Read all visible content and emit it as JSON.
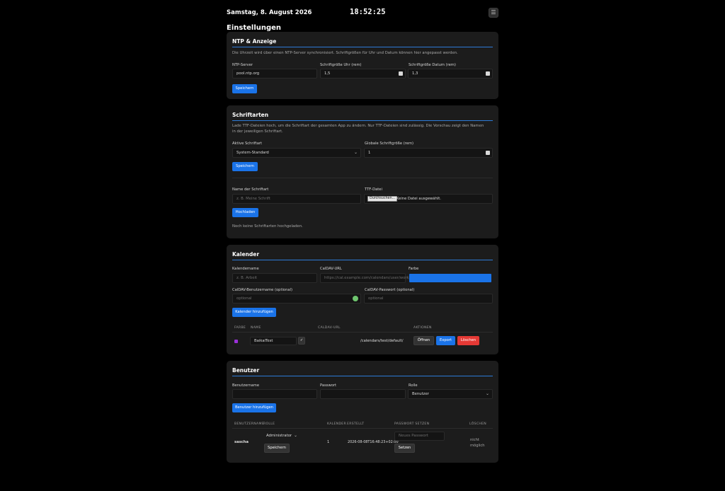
{
  "header": {
    "date": "Samstag, 8. August 2026",
    "clock": "18:52:25",
    "menu_icon": "menu-icon"
  },
  "page_title": "Einstellungen",
  "ntp": {
    "title": "NTP & Anzeige",
    "description": "Die Uhrzeit wird über einen NTP-Server synchronisiert. Schriftgrößen für Uhr und Datum können hier angepasst werden.",
    "server_label": "NTP-Server",
    "server_value": "pool.ntp.org",
    "clock_size_label": "Schriftgröße Uhr (rem)",
    "clock_size_value": "1,5",
    "date_size_label": "Schriftgröße Datum (rem)",
    "date_size_value": "1,3",
    "save": "Speichern"
  },
  "fonts": {
    "title": "Schriftarten",
    "description": "Lade TTF-Dateien hoch, um die Schriftart der gesamten App zu ändern. Nur TTF-Dateien sind zulässig. Die Vorschau zeigt den Namen in der jeweiligen Schriftart.",
    "active_label": "Aktive Schriftart",
    "active_value": "System-Standard",
    "global_size_label": "Globale Schriftgröße (rem)",
    "global_size_value": "1",
    "save": "Speichern",
    "name_label": "Name der Schriftart",
    "name_placeholder": "z. B. Meine Schrift",
    "file_label": "TTF-Datei",
    "file_button": "Durchsuchen...",
    "file_status": "Keine Datei ausgewählt.",
    "upload": "Hochladen",
    "empty": "Noch keine Schriftarten hochgeladen."
  },
  "calendar": {
    "title": "Kalender",
    "name_label": "Kalendername",
    "name_placeholder": "z. B. Arbeit",
    "url_label": "CalDAV-URL",
    "url_placeholder": "https://cal.example.com/calendars/user/work/",
    "color_label": "Farbe",
    "color_value": "#1a73e8",
    "user_label": "CalDAV-Benutzername (optional)",
    "user_placeholder": "optional",
    "pass_label": "CalDAV-Passwort (optional)",
    "pass_placeholder": "optional",
    "add": "Kalender hinzufügen",
    "columns": {
      "color": "FARBE",
      "name": "NAME",
      "url": "CALDAV-URL",
      "actions": "AKTIONEN"
    },
    "rows": [
      {
        "color": "#9b30d9",
        "name": "BaikalTest",
        "url": "/calendars/test/default/",
        "open": "Öffnen",
        "export": "Export",
        "delete": "Löschen"
      }
    ]
  },
  "users": {
    "title": "Benutzer",
    "username_label": "Benutzername",
    "password_label": "Passwort",
    "role_label": "Rolle",
    "role_value": "Benutzer",
    "add": "Benutzer hinzufügen",
    "columns": {
      "username": "BENUTZERNAME",
      "role": "ROLLE",
      "calendars": "KALENDER",
      "created": "ERSTELLT",
      "set_password": "PASSWORT SETZEN",
      "delete": "LÖSCHEN"
    },
    "rows": [
      {
        "username": "sascha",
        "role": "Administrator",
        "save": "Speichern",
        "calendars": "1",
        "created": "2026-08-08T16:48:23+02:00",
        "new_password_placeholder": "Neues Passwort",
        "set": "Setzen",
        "delete_line1": "nicht",
        "delete_line2": "möglich"
      }
    ]
  }
}
